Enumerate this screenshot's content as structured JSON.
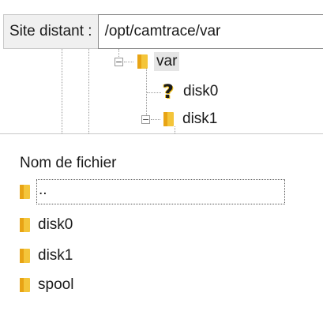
{
  "remote_site": {
    "label": "Site distant :",
    "path": "/opt/camtrace/var"
  },
  "tree": {
    "nodes": [
      {
        "label": "var",
        "icon": "folder-icon",
        "expander": "−"
      },
      {
        "label": "disk0",
        "icon": "unknown-question-icon"
      },
      {
        "label": "disk1",
        "icon": "folder-icon",
        "expander": "−"
      }
    ]
  },
  "file_list": {
    "column_header": "Nom de fichier",
    "rows": [
      {
        "name": "..",
        "icon": "folder-icon"
      },
      {
        "name": "disk0",
        "icon": "folder-icon"
      },
      {
        "name": "disk1",
        "icon": "folder-icon"
      },
      {
        "name": "spool",
        "icon": "folder-icon"
      }
    ]
  },
  "colors": {
    "folder": "#f4c53a",
    "folder_dark": "#e8a415",
    "selection": "#e5e5e5"
  }
}
